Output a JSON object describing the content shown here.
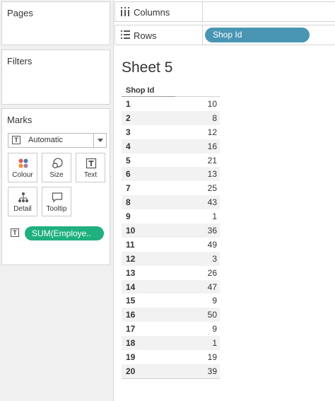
{
  "left_panel": {
    "pages_title": "Pages",
    "filters_title": "Filters",
    "marks": {
      "title": "Marks",
      "mark_type": "Automatic",
      "buttons": [
        {
          "label": "Colour",
          "icon": "colour-icon"
        },
        {
          "label": "Size",
          "icon": "size-icon"
        },
        {
          "label": "Text",
          "icon": "text-icon"
        },
        {
          "label": "Detail",
          "icon": "detail-icon"
        },
        {
          "label": "Tooltip",
          "icon": "tooltip-icon"
        }
      ],
      "field_pill": "SUM(Employe.."
    }
  },
  "shelves": {
    "columns_label": "Columns",
    "rows_label": "Rows",
    "rows_pill": "Shop Id"
  },
  "sheet": {
    "title": "Sheet 5",
    "column_header": "Shop Id",
    "rows": [
      {
        "id": "1",
        "value": "10"
      },
      {
        "id": "2",
        "value": "8"
      },
      {
        "id": "3",
        "value": "12"
      },
      {
        "id": "4",
        "value": "16"
      },
      {
        "id": "5",
        "value": "21"
      },
      {
        "id": "6",
        "value": "13"
      },
      {
        "id": "7",
        "value": "25"
      },
      {
        "id": "8",
        "value": "43"
      },
      {
        "id": "9",
        "value": "1"
      },
      {
        "id": "10",
        "value": "36"
      },
      {
        "id": "11",
        "value": "49"
      },
      {
        "id": "12",
        "value": "3"
      },
      {
        "id": "13",
        "value": "26"
      },
      {
        "id": "14",
        "value": "47"
      },
      {
        "id": "15",
        "value": "9"
      },
      {
        "id": "16",
        "value": "50"
      },
      {
        "id": "17",
        "value": "9"
      },
      {
        "id": "18",
        "value": "1"
      },
      {
        "id": "19",
        "value": "19"
      },
      {
        "id": "20",
        "value": "39"
      }
    ]
  },
  "colors": {
    "rows_pill": "#4896b3",
    "measure_pill": "#1fb07e"
  }
}
